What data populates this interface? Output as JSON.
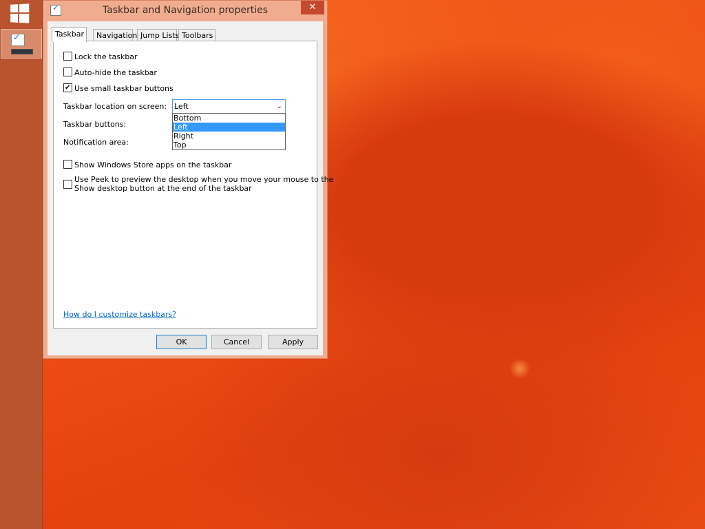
{
  "window": {
    "title": "Taskbar and Navigation properties",
    "close_glyph": "✕"
  },
  "tabs": [
    {
      "label": "Taskbar",
      "active": true
    },
    {
      "label": "Navigation",
      "active": false
    },
    {
      "label": "Jump Lists",
      "active": false
    },
    {
      "label": "Toolbars",
      "active": false
    }
  ],
  "options": {
    "lock_taskbar": {
      "label": "Lock the taskbar",
      "checked": false
    },
    "auto_hide": {
      "label": "Auto-hide the taskbar",
      "checked": false
    },
    "small_buttons": {
      "label": "Use small taskbar buttons",
      "checked": true
    },
    "store_apps": {
      "label": "Show Windows Store apps on the taskbar",
      "checked": false
    },
    "peek_line1": "Use Peek to preview the desktop when you move your mouse to the",
    "peek_line2": "Show desktop button at the end of the taskbar",
    "peek_checked": false
  },
  "location": {
    "label": "Taskbar location on screen:",
    "value": "Left",
    "options": [
      "Bottom",
      "Left",
      "Right",
      "Top"
    ],
    "selected_index": 1
  },
  "buttons_label": "Taskbar buttons:",
  "notification_label": "Notification area:",
  "help_link": "How do I customize taskbars?",
  "footer": {
    "ok": "OK",
    "cancel": "Cancel",
    "apply": "Apply"
  },
  "icons": {
    "start": "windows-logo-icon",
    "taskbar_app": "taskbar-properties-icon"
  },
  "colors": {
    "taskbar": "#b9542e",
    "window_frame": "#f0ac8f",
    "close_button": "#c7472f",
    "selection": "#3399ff",
    "link": "#0066cc"
  }
}
